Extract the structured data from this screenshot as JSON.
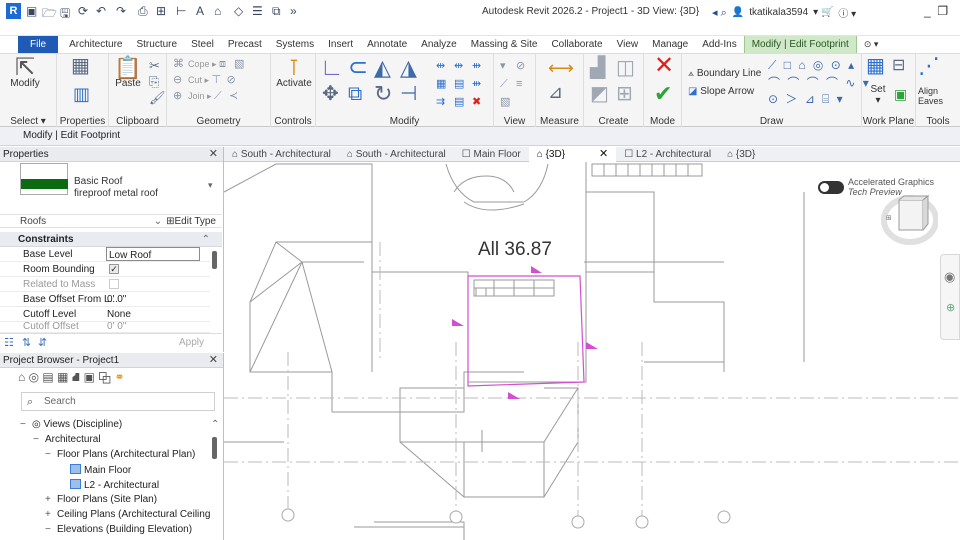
{
  "app": {
    "logo": "R",
    "title": "Autodesk Revit 2026.2 - Project1 - 3D View: {3D}",
    "user": "tkatikala3594"
  },
  "ribbon_tabs": [
    "File",
    "Architecture",
    "Structure",
    "Steel",
    "Precast",
    "Systems",
    "Insert",
    "Annotate",
    "Analyze",
    "Massing & Site",
    "Collaborate",
    "View",
    "Manage",
    "Add-Ins",
    "Modify | Edit Footprint"
  ],
  "ribbon": {
    "select": "Select",
    "properties": "Properties",
    "clipboard": "Clipboard",
    "geometry": "Geometry",
    "controls": "Controls",
    "modify": "Modify",
    "view": "View",
    "measure": "Measure",
    "create": "Create",
    "mode": "Mode",
    "draw": "Draw",
    "work_plane": "Work Plane",
    "tools": "Tools",
    "modify_btn": "Modify",
    "paste": "Paste",
    "activate": "Activate",
    "cope": "Cope",
    "cut": "Cut",
    "join": "Join",
    "boundary_line": "Boundary Line",
    "slope_arrow": "Slope Arrow",
    "set": "Set",
    "align_eaves": "Align Eaves"
  },
  "context_bar": "Modify | Edit Footprint",
  "properties_panel": {
    "header": "Properties",
    "type_family": "Basic Roof",
    "type_name": "fireproof metal roof",
    "category": "Roofs",
    "edit_type": "Edit Type",
    "section": "Constraints",
    "rows": [
      {
        "key": "Base Level",
        "value": "Low Roof"
      },
      {
        "key": "Room Bounding",
        "value": "✓"
      },
      {
        "key": "Related to Mass",
        "value": ""
      },
      {
        "key": "Base Offset From L...",
        "value": "0'  0\""
      },
      {
        "key": "Cutoff Level",
        "value": "None"
      },
      {
        "key": "Cutoff Offset",
        "value": "0'  0\""
      }
    ],
    "apply": "Apply"
  },
  "project_browser": {
    "header": "Project Browser - Project1",
    "search_placeholder": "Search",
    "nodes": [
      {
        "toggle": "−",
        "label": "Views (Discipline)"
      },
      {
        "toggle": "−",
        "label": "Architectural"
      },
      {
        "toggle": "−",
        "label": "Floor Plans (Architectural Plan)"
      },
      {
        "toggle": "",
        "label": "Main Floor"
      },
      {
        "toggle": "",
        "label": "L2 - Architectural"
      },
      {
        "toggle": "+",
        "label": "Floor Plans (Site Plan)"
      },
      {
        "toggle": "+",
        "label": "Ceiling Plans (Architectural Ceiling Pla"
      },
      {
        "toggle": "−",
        "label": "Elevations (Building Elevation)"
      }
    ]
  },
  "view_tabs": [
    "South - Architectural",
    "South - Architectural",
    "Main Floor",
    "{3D}",
    "L2 - Architectural",
    "{3D}"
  ],
  "canvas": {
    "slope_label": "All 36.87",
    "accel_line1": "Accelerated Graphics",
    "accel_line2": "Tech Preview"
  }
}
